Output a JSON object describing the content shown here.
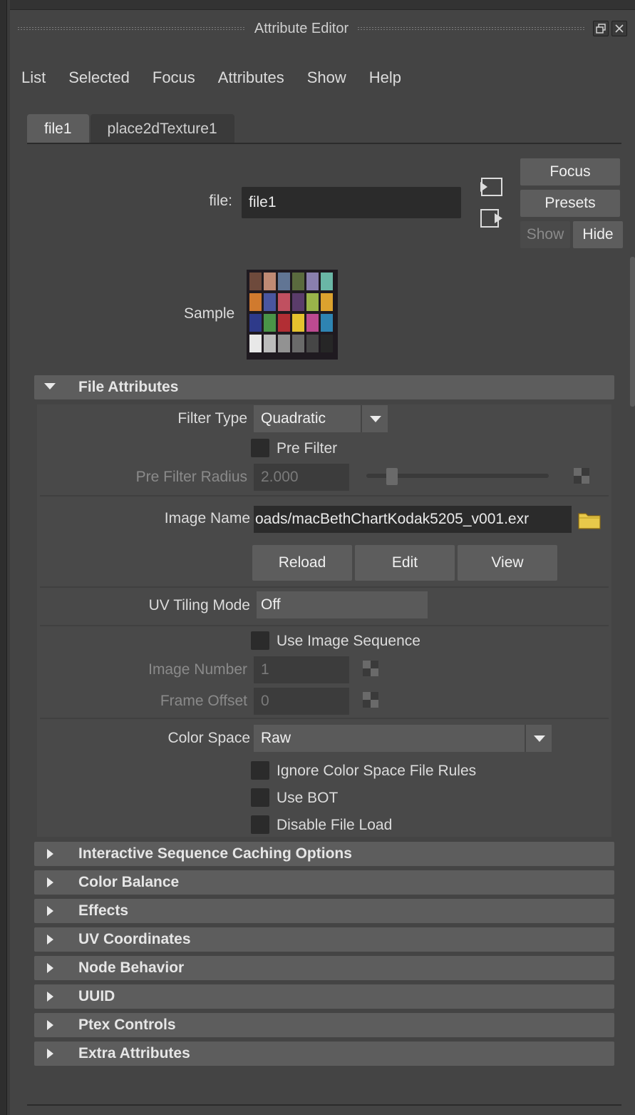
{
  "window": {
    "title": "Attribute Editor"
  },
  "menu": [
    "List",
    "Selected",
    "Focus",
    "Attributes",
    "Show",
    "Help"
  ],
  "tabs": [
    {
      "label": "file1",
      "active": true
    },
    {
      "label": "place2dTexture1",
      "active": false
    }
  ],
  "node": {
    "file_label": "file:",
    "file_value": "file1",
    "focus_label": "Focus",
    "presets_label": "Presets",
    "show_label": "Show",
    "hide_label": "Hide",
    "sample_label": "Sample"
  },
  "file_attributes": {
    "header": "File Attributes",
    "filter_type_label": "Filter Type",
    "filter_type_value": "Quadratic",
    "pre_filter_label": "Pre Filter",
    "pre_filter_radius_label": "Pre Filter Radius",
    "pre_filter_radius_value": "2.000",
    "image_name_label": "Image Name",
    "image_name_value": "oads/macBethChartKodak5205_v001.exr",
    "reload_label": "Reload",
    "edit_label": "Edit",
    "view_label": "View",
    "uv_tiling_label": "UV Tiling Mode",
    "uv_tiling_value": "Off",
    "use_image_sequence_label": "Use Image Sequence",
    "image_number_label": "Image Number",
    "image_number_value": "1",
    "frame_offset_label": "Frame Offset",
    "frame_offset_value": "0",
    "color_space_label": "Color Space",
    "color_space_value": "Raw",
    "ignore_cs_rules_label": "Ignore Color Space File Rules",
    "use_bot_label": "Use BOT",
    "disable_file_load_label": "Disable File Load"
  },
  "collapsed_sections": [
    "Interactive Sequence Caching Options",
    "Color Balance",
    "Effects",
    "UV Coordinates",
    "Node Behavior",
    "UUID",
    "Ptex Controls",
    "Extra Attributes"
  ],
  "colors": {
    "panel_bg": "#444444",
    "header_bg": "#5d5d5d",
    "field_bg": "#2b2b2b",
    "folder": "#e8c94a"
  },
  "icons": {
    "float": "float-window-icon",
    "close": "close-icon",
    "input_connection": "input-connection-icon",
    "output_connection": "output-connection-icon",
    "folder": "folder-icon",
    "map": "checker-map-icon"
  }
}
